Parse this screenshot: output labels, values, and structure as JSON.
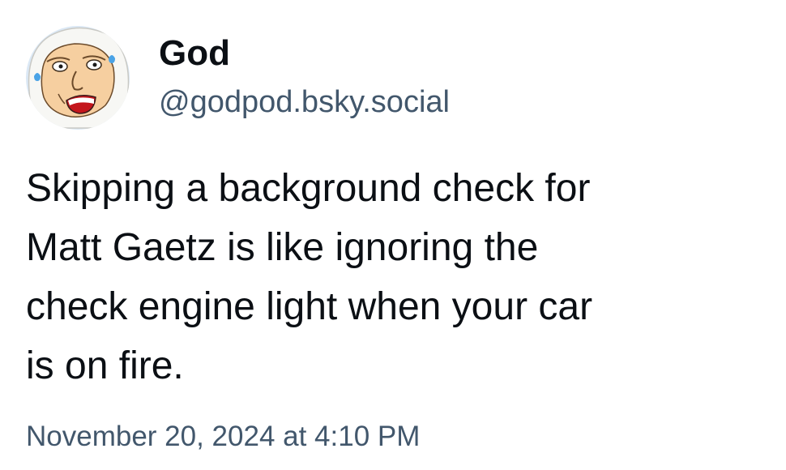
{
  "author": {
    "display_name": "God",
    "handle": "@godpod.bsky.social",
    "avatar_icon": "cartoon-god-avatar-icon"
  },
  "post": {
    "lines": [
      "Skipping a background check for",
      "Matt Gaetz is like ignoring the",
      "check engine light when your car",
      "is on fire."
    ],
    "timestamp": "November 20, 2024 at 4:10 PM"
  },
  "colors": {
    "text_primary": "#0b0f14",
    "text_secondary": "#42576c",
    "background": "#ffffff"
  }
}
